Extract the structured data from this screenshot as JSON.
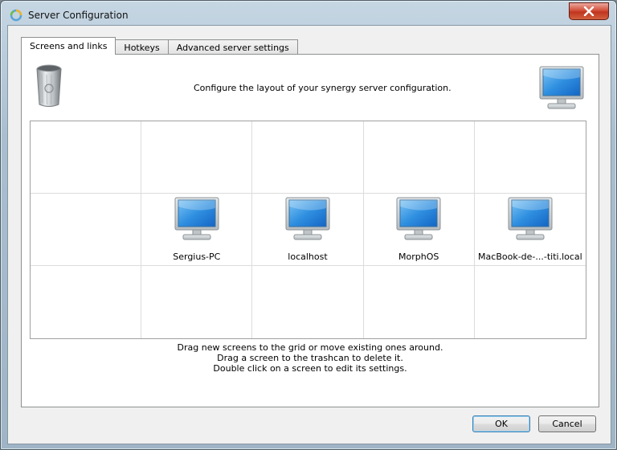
{
  "window": {
    "title": "Server Configuration"
  },
  "tabs": [
    {
      "label": "Screens and links",
      "active": true
    },
    {
      "label": "Hotkeys",
      "active": false
    },
    {
      "label": "Advanced server settings",
      "active": false
    }
  ],
  "config_text": "Configure the layout of your synergy server configuration.",
  "grid": {
    "rows": 3,
    "columns": 5,
    "screens": [
      {
        "row": 2,
        "column": 2,
        "name": "Sergius-PC"
      },
      {
        "row": 2,
        "column": 3,
        "name": "localhost"
      },
      {
        "row": 2,
        "column": 4,
        "name": "MorphOS"
      },
      {
        "row": 2,
        "column": 5,
        "name": "MacBook-de-...-titi.local"
      }
    ]
  },
  "instructions": [
    "Drag new screens to the grid or move existing ones around.",
    "Drag a screen to the trashcan to delete it.",
    "Double click on a screen to edit its settings."
  ],
  "buttons": {
    "ok": "OK",
    "cancel": "Cancel"
  },
  "icons": {
    "app": "synergy-icon",
    "trash": "trashcan-icon",
    "new_screen": "monitor-icon",
    "close": "close-icon"
  }
}
